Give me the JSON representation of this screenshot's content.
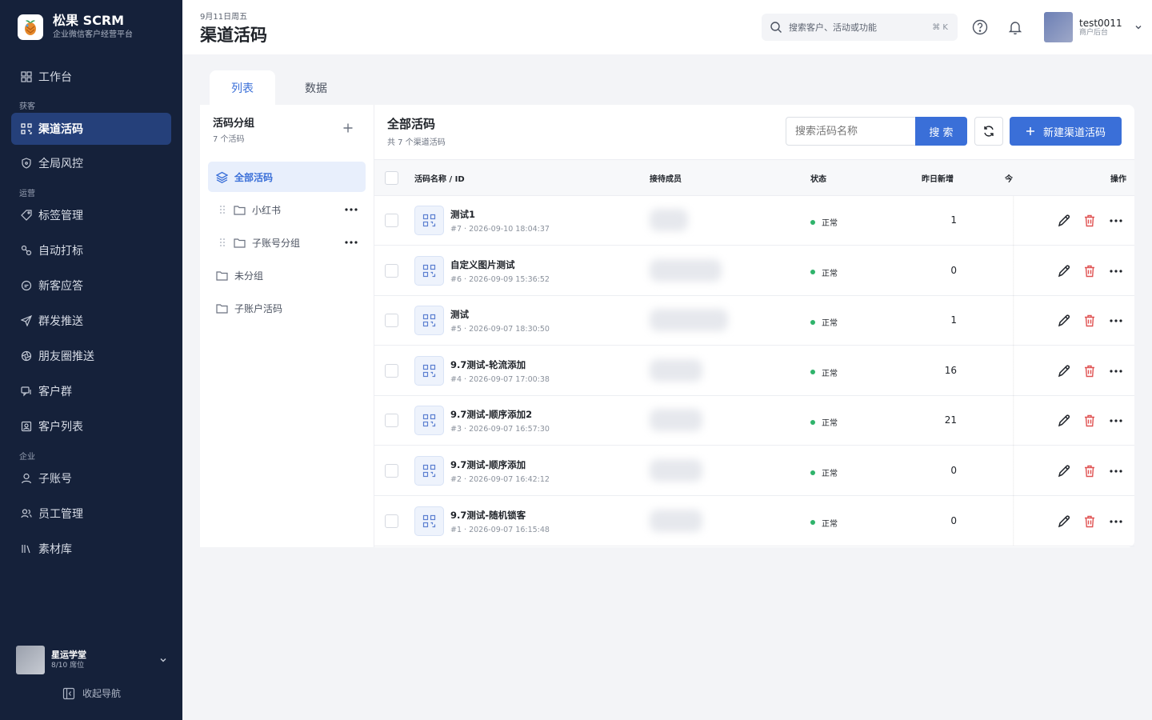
{
  "brand": {
    "name": "松果 SCRM",
    "subtitle": "企业微信客户经营平台"
  },
  "sidebar": {
    "items": [
      {
        "label": "工作台",
        "icon": "grid-icon"
      },
      {
        "group": "获客"
      },
      {
        "label": "渠道活码",
        "icon": "qrcode-icon",
        "active": true
      },
      {
        "label": "全局风控",
        "icon": "shield-icon"
      },
      {
        "group": "运营"
      },
      {
        "label": "标签管理",
        "icon": "tag-icon"
      },
      {
        "label": "自动打标",
        "icon": "link-icon"
      },
      {
        "label": "新客应答",
        "icon": "message-icon"
      },
      {
        "label": "群发推送",
        "icon": "send-icon"
      },
      {
        "label": "朋友圈推送",
        "icon": "aperture-icon"
      },
      {
        "label": "客户群",
        "icon": "chat-group-icon"
      },
      {
        "label": "客户列表",
        "icon": "contact-icon"
      },
      {
        "group": "企业"
      },
      {
        "label": "子账号",
        "icon": "user-icon"
      },
      {
        "label": "员工管理",
        "icon": "users-icon"
      },
      {
        "label": "素材库",
        "icon": "library-icon"
      }
    ],
    "groups": {
      "acquire": "获客",
      "operate": "运营",
      "enterprise": "企业"
    },
    "labels": {
      "workbench": "工作台",
      "channel_code": "渠道活码",
      "risk": "全局风控",
      "tags": "标签管理",
      "auto_tag": "自动打标",
      "welcome": "新客应答",
      "broadcast": "群发推送",
      "moments": "朋友圈推送",
      "groups": "客户群",
      "customers": "客户列表",
      "sub_accounts": "子账号",
      "staff": "员工管理",
      "materials": "素材库"
    },
    "org": {
      "name": "星运学堂",
      "seats": "8/10 席位"
    },
    "collapse_label": "收起导航"
  },
  "header": {
    "date": "9月11日周五",
    "title": "渠道活码",
    "search_placeholder": "搜索客户、活动或功能",
    "shortcut": "⌘ K",
    "user": {
      "name": "test0011",
      "role": "商户后台"
    }
  },
  "tabs": {
    "list": "列表",
    "data": "数据",
    "active": "列表"
  },
  "groups_panel": {
    "title": "活码分组",
    "count": "7 个活码",
    "items": {
      "all": "全部活码",
      "xhs": "小红书",
      "sub_group": "子账号分组",
      "ungrouped": "未分组",
      "sub_codes": "子账户活码"
    }
  },
  "main": {
    "title": "全部活码",
    "count": "共 7 个渠道活码",
    "search_placeholder": "搜索活码名称",
    "search_button": "搜 索",
    "new_button": "新建渠道活码",
    "columns": {
      "name": "活码名称 / ID",
      "staff": "接待成员",
      "status": "状态",
      "new_yesterday": "昨日新增",
      "today": "今",
      "actions": "操作"
    },
    "rows": [
      {
        "name": "测试1",
        "meta": "#7 · 2026-09-10 18:04:37",
        "status": "正常",
        "new": "1"
      },
      {
        "name": "自定义图片测试",
        "meta": "#6 · 2026-09-09 15:36:52",
        "status": "正常",
        "new": "0"
      },
      {
        "name": "测试",
        "meta": "#5 · 2026-09-07 18:30:50",
        "status": "正常",
        "new": "1"
      },
      {
        "name": "9.7测试-轮流添加",
        "meta": "#4 · 2026-09-07 17:00:38",
        "status": "正常",
        "new": "16"
      },
      {
        "name": "9.7测试-顺序添加2",
        "meta": "#3 · 2026-09-07 16:57:30",
        "status": "正常",
        "new": "21"
      },
      {
        "name": "9.7测试-顺序添加",
        "meta": "#2 · 2026-09-07 16:42:12",
        "status": "正常",
        "new": "0"
      },
      {
        "name": "9.7测试-随机锁客",
        "meta": "#1 · 2026-09-07 16:15:48",
        "status": "正常",
        "new": "0"
      }
    ]
  },
  "colors": {
    "primary": "#3a6fd8",
    "sidebar_bg": "#15213a",
    "sidebar_active": "#25407a",
    "status_ok": "#2fb36b",
    "delete": "#e05252"
  }
}
